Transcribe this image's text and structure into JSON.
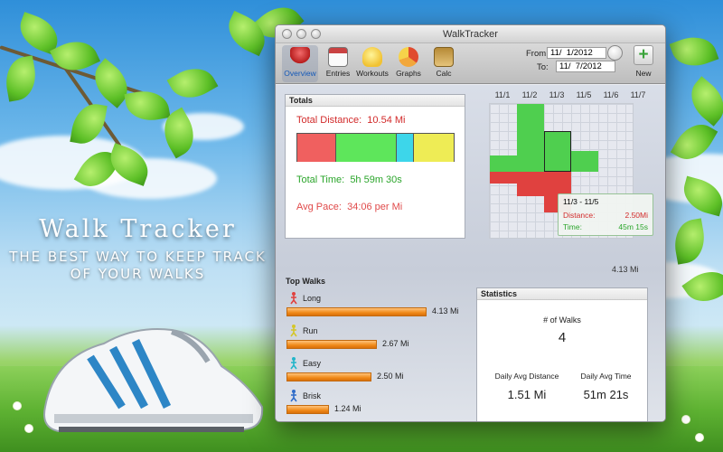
{
  "promo": {
    "title": "Walk Tracker",
    "subtitle_line1": "the best way to keep track",
    "subtitle_line2": "of your WALKS"
  },
  "window": {
    "title": "WalkTracker",
    "toolbar": {
      "items": [
        {
          "label": "Overview",
          "icon": "pin-icon",
          "active": true
        },
        {
          "label": "Entries",
          "icon": "calendar-icon",
          "active": false
        },
        {
          "label": "Workouts",
          "icon": "lightbulb-icon",
          "active": false
        },
        {
          "label": "Graphs",
          "icon": "pie-chart-icon",
          "active": false
        },
        {
          "label": "Calc",
          "icon": "calculator-icon",
          "active": false
        }
      ],
      "from_label": "From:",
      "from_value": "11/  1/2012",
      "to_label": "To:",
      "to_value": "11/  7/2012",
      "new_label": "New"
    }
  },
  "totals": {
    "heading": "Totals",
    "distance_label": "Total Distance:",
    "distance_value": "10.54 Mi",
    "time_label": "Total Time:",
    "time_value": "5h 59m 30s",
    "pace_label": "Avg Pace:",
    "pace_value": "34:06 per Mi",
    "breakdown": [
      {
        "color": "#f0605f",
        "fraction": 0.24
      },
      {
        "color": "#5ee65b",
        "fraction": 0.39
      },
      {
        "color": "#3dd6ea",
        "fraction": 0.11
      },
      {
        "color": "#eeec55",
        "fraction": 0.26
      }
    ]
  },
  "chart_data": {
    "type": "bar",
    "categories": [
      "11/1",
      "11/2",
      "11/3",
      "11/5",
      "11/6",
      "11/7"
    ],
    "max_label": "4.13 Mi",
    "series": [
      {
        "values": [
          1.0,
          4.13,
          2.5,
          1.24,
          0,
          0
        ],
        "color": "#4fcf4f"
      },
      {
        "values": [
          0.7,
          1.5,
          2.5,
          0,
          0,
          0
        ],
        "color": "#e0413f"
      }
    ],
    "tooltip": {
      "title": "11/3 - 11/5",
      "distance_label": "Distance:",
      "distance_value": "2.50Mi",
      "time_label": "Time:",
      "time_value": "45m 15s"
    }
  },
  "top_walks": {
    "heading": "Top Walks",
    "items": [
      {
        "name": "Long",
        "value": "4.13 Mi",
        "miles": 4.13,
        "icon": "runner-red-icon",
        "icon_color": "#e0413f"
      },
      {
        "name": "Run",
        "value": "2.67 Mi",
        "miles": 2.67,
        "icon": "runner-yellow-icon",
        "icon_color": "#d4c62a"
      },
      {
        "name": "Easy",
        "value": "2.50 Mi",
        "miles": 2.5,
        "icon": "runner-cyan-icon",
        "icon_color": "#22b5c9"
      },
      {
        "name": "Brisk",
        "value": "1.24 Mi",
        "miles": 1.24,
        "icon": "runner-blue-icon",
        "icon_color": "#2f6cc9"
      }
    ]
  },
  "statistics": {
    "heading": "Statistics",
    "walks_label": "# of Walks",
    "walks_value": "4",
    "avg_distance_label": "Daily Avg Distance",
    "avg_distance_value": "1.51 Mi",
    "avg_time_label": "Daily Avg Time",
    "avg_time_value": "51m 21s"
  }
}
